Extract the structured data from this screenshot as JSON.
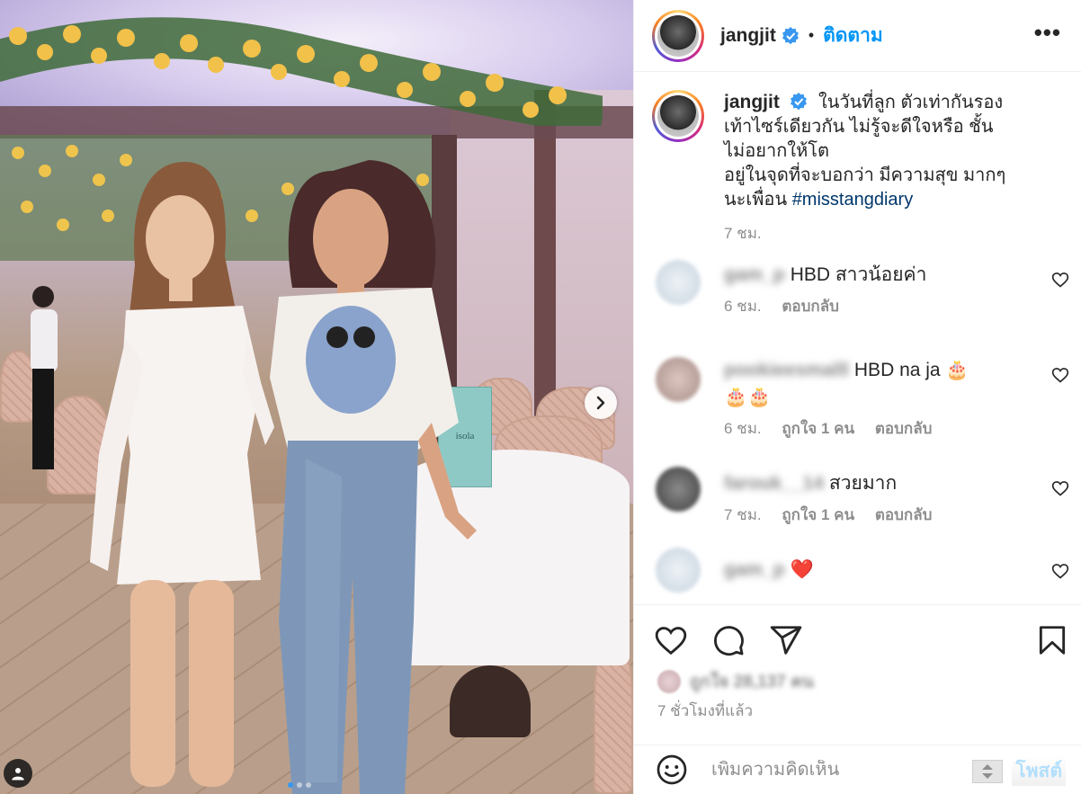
{
  "post": {
    "username": "jangjit",
    "follow_label": "ติดตาม",
    "bullet": "•",
    "more_label": "•••",
    "caption_line1": "ในวันที่ลูก ตัวเท่ากันรอง",
    "caption_line2": "เท้าไซร์เดียวกัน ไม่รู้จะดีใจหรือ ชั้น",
    "caption_line3": "ไม่อยากให้โต",
    "caption_line4": "อยู่ในจุดที่จะบอกว่า มีความสุข มากๆ",
    "caption_line5": "นะเพื่อน",
    "hashtag": "#misstangdiary",
    "caption_time": "7 ชม.",
    "likes_text": "ถูกใจ 28,137 คน",
    "post_time": "7 ชั่วโมงที่แล้ว",
    "comment_placeholder": "เพิ่มความคิดเห็น",
    "post_label": "โพสต์"
  },
  "comments": [
    {
      "name": "gam_p",
      "text": "HBD สาวน้อยค่า",
      "time": "6 ชม.",
      "likes": "",
      "reply": "ตอบกลับ",
      "avatar": "#dfe7ef"
    },
    {
      "name": "pookieesmalll",
      "text": "HBD na ja 🎂",
      "text2": "🎂🎂",
      "time": "6 ชม.",
      "likes": "ถูกใจ 1 คน",
      "reply": "ตอบกลับ",
      "avatar": "#c9b3ad"
    },
    {
      "name": "farouk__14",
      "text": "สวยมาก",
      "time": "7 ชม.",
      "likes": "ถูกใจ 1 คน",
      "reply": "ตอบกลับ",
      "avatar": "#5a5a5a"
    },
    {
      "name": "gam_p",
      "text": "❤️",
      "time": "",
      "likes": "",
      "reply": "",
      "avatar": "#dfe7ef"
    }
  ],
  "photo": {
    "menu_text": "isola"
  },
  "colors": {
    "accent_blue": "#0095f6",
    "hashtag": "#00376b",
    "muted": "#8e8e8e",
    "heart": "#ed4956"
  },
  "icons": [
    "verified-badge-icon",
    "more-icon",
    "heart-icon",
    "comment-icon",
    "share-icon",
    "bookmark-icon",
    "emoji-icon",
    "chevron-right-icon",
    "user-tag-icon"
  ]
}
